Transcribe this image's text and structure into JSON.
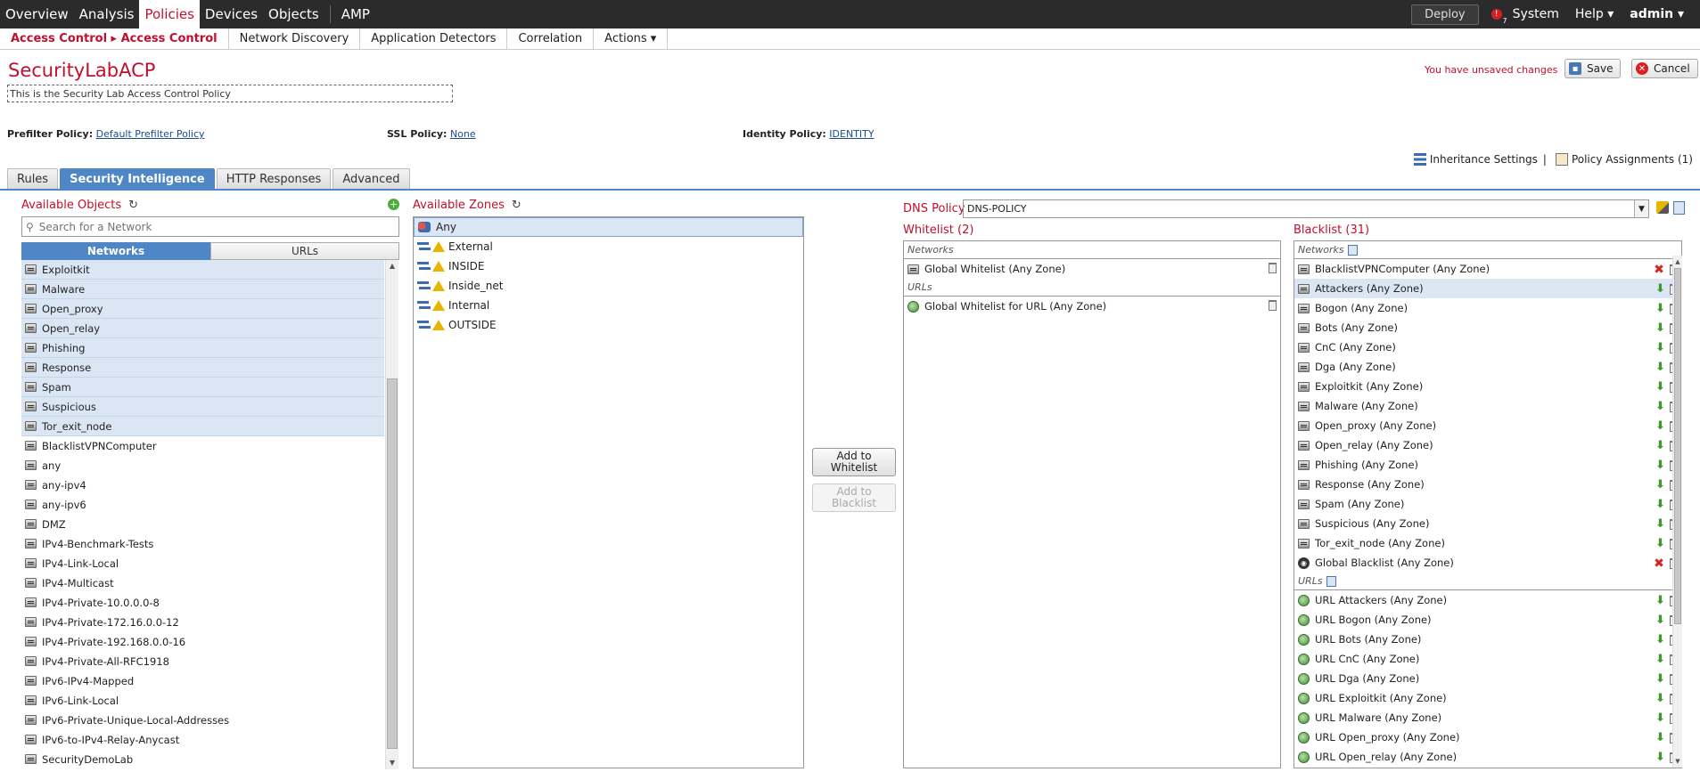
{
  "topnav": {
    "items": [
      "Overview",
      "Analysis",
      "Policies",
      "Devices",
      "Objects",
      "AMP"
    ],
    "active": "Policies",
    "deploy": "Deploy",
    "alert_count": "7",
    "system": "System",
    "help": "Help ▾",
    "user": "admin ▾"
  },
  "subnav": {
    "breadcrumb": "Access Control ▸ Access Control",
    "items": [
      "Network Discovery",
      "Application Detectors",
      "Correlation",
      "Actions ▾"
    ]
  },
  "policy": {
    "name": "SecurityLabACP",
    "description": "This is the Security Lab Access Control Policy",
    "unsaved": "You have unsaved changes",
    "save": "Save",
    "cancel": "Cancel",
    "prefilter_label": "Prefilter Policy:",
    "prefilter_value": "Default Prefilter Policy",
    "ssl_label": "SSL Policy:",
    "ssl_value": "None",
    "identity_label": "Identity Policy:",
    "identity_value": "IDENTITY",
    "inheritance": "Inheritance Settings",
    "assignments": "Policy Assignments (1)"
  },
  "tabs": [
    "Rules",
    "Security Intelligence",
    "HTTP Responses",
    "Advanced"
  ],
  "objects": {
    "title": "Available Objects",
    "search_placeholder": "Search for a Network",
    "tab_networks": "Networks",
    "tab_urls": "URLs",
    "selected_items": [
      "Exploitkit",
      "Malware",
      "Open_proxy",
      "Open_relay",
      "Phishing",
      "Response",
      "Spam",
      "Suspicious",
      "Tor_exit_node"
    ],
    "items": [
      "BlacklistVPNComputer",
      "any",
      "any-ipv4",
      "any-ipv6",
      "DMZ",
      "IPv4-Benchmark-Tests",
      "IPv4-Link-Local",
      "IPv4-Multicast",
      "IPv4-Private-10.0.0.0-8",
      "IPv4-Private-172.16.0.0-12",
      "IPv4-Private-192.168.0.0-16",
      "IPv4-Private-All-RFC1918",
      "IPv6-IPv4-Mapped",
      "IPv6-Link-Local",
      "IPv6-Private-Unique-Local-Addresses",
      "IPv6-to-IPv4-Relay-Anycast",
      "SecurityDemoLab"
    ]
  },
  "zones": {
    "title": "Available Zones",
    "any": "Any",
    "items": [
      "External",
      "INSIDE",
      "Inside_net",
      "Internal",
      "OUTSIDE"
    ]
  },
  "buttons": {
    "add_whitelist": [
      "Add to",
      "Whitelist"
    ],
    "add_blacklist": [
      "Add to",
      "Blacklist"
    ]
  },
  "dns": {
    "label": "DNS Policy",
    "value": "DNS-POLICY"
  },
  "whitelist": {
    "title": "Whitelist (2)",
    "networks_header": "Networks",
    "networks": [
      "Global Whitelist (Any Zone)"
    ],
    "urls_header": "URLs",
    "urls": [
      "Global Whitelist for URL (Any Zone)"
    ]
  },
  "blacklist": {
    "title": "Blacklist (31)",
    "networks_header": "Networks",
    "networks": [
      {
        "label": "BlacklistVPNComputer (Any Zone)",
        "action": "delete"
      },
      {
        "label": "Attackers (Any Zone)",
        "action": "down"
      },
      {
        "label": "Bogon (Any Zone)",
        "action": "down"
      },
      {
        "label": "Bots (Any Zone)",
        "action": "down"
      },
      {
        "label": "CnC (Any Zone)",
        "action": "down"
      },
      {
        "label": "Dga (Any Zone)",
        "action": "down"
      },
      {
        "label": "Exploitkit (Any Zone)",
        "action": "down"
      },
      {
        "label": "Malware (Any Zone)",
        "action": "down"
      },
      {
        "label": "Open_proxy (Any Zone)",
        "action": "down"
      },
      {
        "label": "Open_relay (Any Zone)",
        "action": "down"
      },
      {
        "label": "Phishing (Any Zone)",
        "action": "down"
      },
      {
        "label": "Response (Any Zone)",
        "action": "down"
      },
      {
        "label": "Spam (Any Zone)",
        "action": "down"
      },
      {
        "label": "Suspicious (Any Zone)",
        "action": "down"
      },
      {
        "label": "Tor_exit_node (Any Zone)",
        "action": "down"
      },
      {
        "label": "Global Blacklist (Any Zone)",
        "action": "delete"
      }
    ],
    "urls_header": "URLs",
    "urls": [
      "URL Attackers (Any Zone)",
      "URL Bogon (Any Zone)",
      "URL Bots (Any Zone)",
      "URL CnC (Any Zone)",
      "URL Dga (Any Zone)",
      "URL Exploitkit (Any Zone)",
      "URL Malware (Any Zone)",
      "URL Open_proxy (Any Zone)",
      "URL Open_relay (Any Zone)"
    ]
  },
  "colors": {
    "accent": "#c0102e",
    "tab_active": "#4f86c6",
    "selection": "#dbe6f5"
  }
}
